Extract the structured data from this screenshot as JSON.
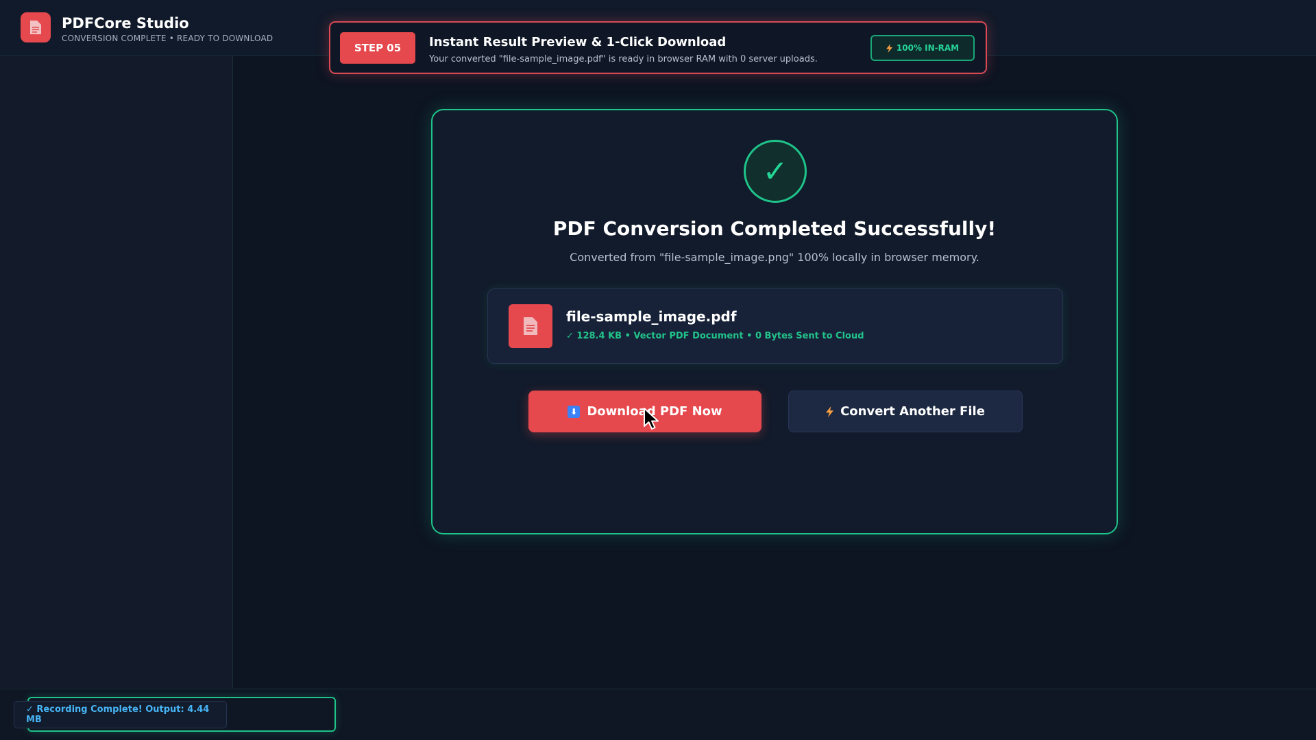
{
  "header": {
    "app_title": "PDFCore Studio",
    "app_subtitle": "CONVERSION COMPLETE • READY TO DOWNLOAD",
    "logo_icon": "document-icon"
  },
  "step_banner": {
    "step_label": "STEP 05",
    "title": "Instant Result Preview & 1-Click Download",
    "description": "Your converted \"file-sample_image.pdf\" is ready in browser RAM with 0 server uploads.",
    "badge_label": "100% IN-RAM",
    "badge_icon": "lightning-icon"
  },
  "card": {
    "check_glyph": "✓",
    "title": "PDF Conversion Completed Successfully!",
    "subtitle": "Converted from \"file-sample_image.png\" 100% locally in browser memory.",
    "file": {
      "name": "file-sample_image.pdf",
      "meta": "✓ 128.4 KB • Vector PDF Document • 0 Bytes Sent to Cloud",
      "icon": "document-icon"
    },
    "download_button": "Download PDF Now",
    "download_icon_glyph": "⬇",
    "convert_button": "Convert Another File"
  },
  "status": {
    "recording": "✓ Recording Complete! Output: 4.44 MB"
  },
  "colors": {
    "accent_red": "#e5484d",
    "accent_green": "#1fc48a",
    "background": "#0d1422",
    "status_blue": "#47b4f5"
  }
}
